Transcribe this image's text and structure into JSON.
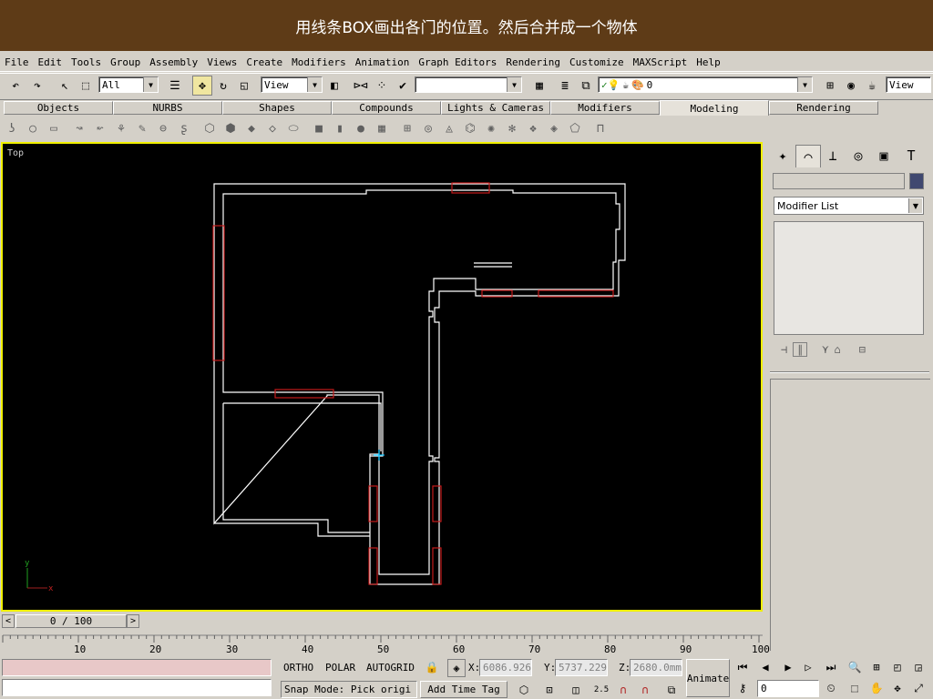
{
  "banner": {
    "text": "用线条BOX画出各门的位置。然后合并成一个物体"
  },
  "menu": [
    "File",
    "Edit",
    "Tools",
    "Group",
    "Assembly",
    "Views",
    "Create",
    "Modifiers",
    "Animation",
    "Graph Editors",
    "Rendering",
    "Customize",
    "MAXScript",
    "Help"
  ],
  "toolbar": {
    "selection_filter": "All",
    "ref_coord": "View",
    "named_selection": "",
    "layer": "0",
    "render_type": "View"
  },
  "tabs": [
    "Objects",
    "NURBS",
    "Shapes",
    "Compounds",
    "Lights & Cameras",
    "Modifiers",
    "Modeling",
    "Rendering"
  ],
  "selected_tab": "Modeling",
  "viewport": {
    "label": "Top",
    "axis_x": "x",
    "axis_y": "y"
  },
  "command_panel": {
    "name_value": "",
    "modifier_list": "Modifier List",
    "object_color": "#404870"
  },
  "timeline": {
    "frame": "0 / 100",
    "ticks": [
      "10",
      "20",
      "30",
      "40",
      "50",
      "60",
      "70",
      "80",
      "90",
      "100"
    ]
  },
  "status": {
    "ortho": "ORTHO",
    "polar": "POLAR",
    "autogrid": "AUTOGRID",
    "x_label": "X:",
    "x_value": "6086.926",
    "y_label": "Y:",
    "y_value": "5737.229",
    "z_label": "Z:",
    "z_value": "2680.0mm",
    "snap_mode": "Snap Mode: Pick origi",
    "add_time_tag": "Add Time Tag",
    "animate": "Animate",
    "frame_value": "0",
    "snap_spinner": "2.5"
  }
}
